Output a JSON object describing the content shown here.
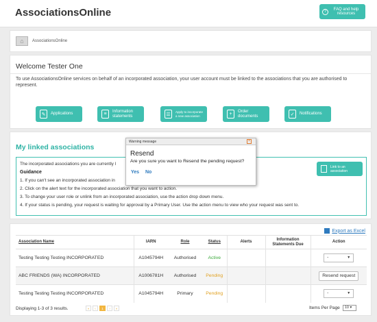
{
  "header": {
    "title": "AssociationsOnline",
    "faq_label": "FAQ and help resources"
  },
  "breadcrumb": {
    "home": "AssociationsOnline"
  },
  "welcome": {
    "title": "Welcome Tester One",
    "text": "To use AssociationsOnline services on behalf of an incorporated association, your user account must be linked to the associations that you are authorised to represent."
  },
  "actions": [
    {
      "label": "Applications",
      "icon": "applications-icon"
    },
    {
      "label": "Information statements",
      "icon": "information-statements-icon"
    },
    {
      "label": "Apply to incorporate a new association",
      "icon": "apply-incorporate-icon"
    },
    {
      "label": "Order documents",
      "icon": "order-documents-icon"
    },
    {
      "label": "Notifications",
      "icon": "notifications-icon"
    }
  ],
  "linked": {
    "title": "My linked associations",
    "intro": "The incorporated associations you are currently l",
    "intro_partial": "n",
    "guidance_title": "Guidance",
    "steps": [
      "1. If you can't see an incorporated association in",
      "2. Click on the alert text for the incorporated association that you want to action.",
      "3. To change your user role or unlink from an incorporated association, use the action drop down menu.",
      "4. If your status is pending, your request is waiting for approval by a Primary User. Use the action menu to view who your request was sent to."
    ],
    "link_button": "Link to an association"
  },
  "table": {
    "export_label": "Export as Excel",
    "columns": [
      "Association Name",
      "IARN",
      "Role",
      "Status",
      "Alerts",
      "Information Statements Due",
      "Action"
    ],
    "rows": [
      {
        "name": "Testing Testing Testing INCORPORATED",
        "iarn": "A1045794H",
        "role": "Authorised",
        "status": "Active",
        "alerts": "",
        "due": "",
        "action": "-"
      },
      {
        "name": "ABC FRIENDS (WA) INCORPORATED",
        "iarn": "A1006781H",
        "role": "Authorised",
        "status": "Pending",
        "alerts": "",
        "due": "",
        "action": "Resend request"
      },
      {
        "name": "Testing Testing Testing INCORPORATED",
        "iarn": "A1045794H",
        "role": "Primary",
        "status": "Pending",
        "alerts": "",
        "due": "",
        "action": "-"
      }
    ],
    "footer": {
      "displaying": "Displaying 1-3 of 3 results.",
      "pages": [
        "«",
        "‹",
        "1",
        "›",
        "»"
      ],
      "current_page": "1",
      "per_page_label": "Items Per Page",
      "per_page_value": "10"
    }
  },
  "modal": {
    "header": "Warning message",
    "title": "Resend",
    "message": "Are you sure you want to Resend the pending request?",
    "yes": "Yes",
    "no": "No",
    "close": "×"
  },
  "colors": {
    "accent": "#3fbfb0",
    "active": "#3aa83a",
    "pending": "#e0a020",
    "link": "#2f7bbf"
  }
}
